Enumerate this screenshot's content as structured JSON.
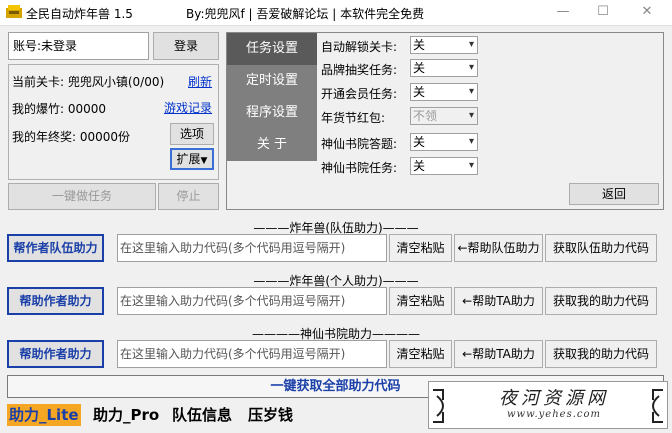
{
  "titlebar": {
    "title": "全民自动炸年兽 1.5",
    "by": "By:兜兜风f | 吾爱破解论坛 | 本软件完全免费",
    "minimize": "—",
    "maximize": "☐",
    "close": "✕"
  },
  "account": {
    "label": "账号:未登录",
    "login_button": "登录"
  },
  "info": {
    "level": "当前关卡: 兜兜风小镇(0/00)",
    "refresh_link": "刷新",
    "firecrackers": "我的爆竹: 00000",
    "game_records_link": "游戏记录",
    "bonus": "我的年终奖: 00000份",
    "options_button": "选项",
    "expand_button": "扩展"
  },
  "actions": {
    "one_key_task": "一键做任务",
    "stop": "停止"
  },
  "tabs": [
    "任务设置",
    "定时设置",
    "程序设置",
    "关 于"
  ],
  "settings": [
    {
      "label": "自动解锁关卡:",
      "value": "关",
      "disabled": false
    },
    {
      "label": "品牌抽奖任务:",
      "value": "关",
      "disabled": false
    },
    {
      "label": "开通会员任务:",
      "value": "关",
      "disabled": false
    },
    {
      "label": "年货节红包:",
      "value": "不领",
      "disabled": true
    },
    {
      "label": "神仙书院答题:",
      "value": "关",
      "disabled": false
    },
    {
      "label": "神仙书院任务:",
      "value": "关",
      "disabled": false
    }
  ],
  "back_button": "返回",
  "sections": [
    {
      "title": "———炸年兽(队伍助力)———",
      "label_button": "帮作者队伍助力",
      "placeholder": "在这里输入助力代码(多个代码用逗号隔开)",
      "clear_button": "清空粘贴",
      "help_button": "←帮助队伍助力",
      "get_button": "获取队伍助力代码"
    },
    {
      "title": "———炸年兽(个人助力)———",
      "label_button": "帮助作者助力",
      "placeholder": "在这里输入助力代码(多个代码用逗号隔开)",
      "clear_button": "清空粘贴",
      "help_button": "←帮助TA助力",
      "get_button": "获取我的助力代码"
    },
    {
      "title": "————神仙书院助力————",
      "label_button": "帮助作者助力",
      "placeholder": "在这里输入助力代码(多个代码用逗号隔开)",
      "clear_button": "清空粘贴",
      "help_button": "←帮助TA助力",
      "get_button": "获取我的助力代码"
    }
  ],
  "get_all_button": "一键获取全部助力代码",
  "bottom_tabs": [
    "助力_Lite",
    "助力_Pro",
    "队伍信息",
    "压岁钱"
  ],
  "watermark": {
    "title": "夜河资源网",
    "url": "www.yehes.com"
  },
  "colors": {
    "accent_blue": "#1a3fa8",
    "active_tab_orange": "#f5a623",
    "tab_side_gray": "#7f7f7f"
  }
}
